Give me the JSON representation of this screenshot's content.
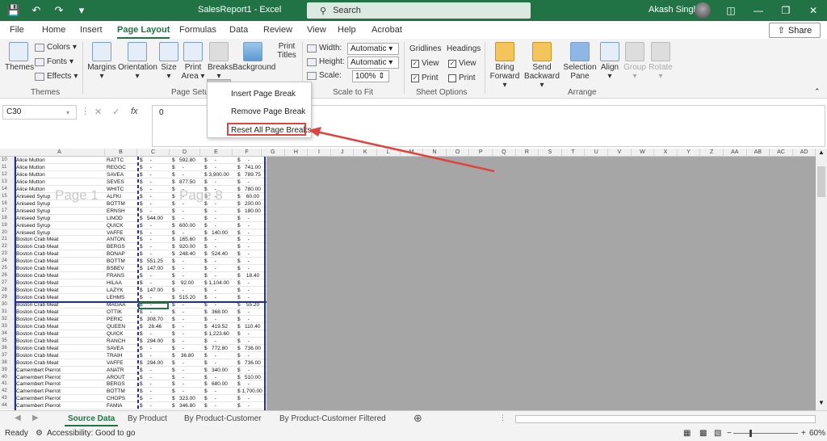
{
  "titlebar": {
    "title": "SalesReport1  -  Excel",
    "search_placeholder": "Search",
    "user_name": "Akash Singh"
  },
  "tabs": [
    "File",
    "Home",
    "Insert",
    "Page Layout",
    "Formulas",
    "Data",
    "Review",
    "View",
    "Help",
    "Acrobat"
  ],
  "active_tab": "Page Layout",
  "share_label": "Share",
  "ribbon": {
    "themes": {
      "themes": "Themes",
      "colors": "Colors",
      "fonts": "Fonts",
      "effects": "Effects",
      "group": "Themes"
    },
    "page_setup": {
      "margins": "Margins",
      "orientation": "Orientation",
      "size": "Size",
      "print_area_1": "Print",
      "print_area_2": "Area",
      "breaks": "Breaks",
      "background": "Background",
      "print_titles_1": "Print",
      "print_titles_2": "Titles",
      "group": "Page Setup"
    },
    "scale": {
      "width_label": "Width:",
      "width_value": "Automatic",
      "height_label": "Height:",
      "height_value": "Automatic",
      "scale_label": "Scale:",
      "scale_value": "100%",
      "group": "Scale to Fit"
    },
    "sheet_options": {
      "gridlines": "Gridlines",
      "headings": "Headings",
      "view": "View",
      "print": "Print",
      "group": "Sheet Options"
    },
    "arrange": {
      "bring_1": "Bring",
      "bring_2": "Forward",
      "send_1": "Send",
      "send_2": "Backward",
      "sel_1": "Selection",
      "sel_2": "Pane",
      "align": "Align",
      "group_btn": "Group",
      "rotate": "Rotate",
      "group": "Arrange"
    }
  },
  "breaks_menu": {
    "insert": "Insert Page Break",
    "remove": "Remove Page Break",
    "reset": "Reset All Page Breaks"
  },
  "formula_bar": {
    "name_box": "C30",
    "value": "0"
  },
  "columns": [
    "A",
    "B",
    "C",
    "D",
    "E",
    "F",
    "G",
    "H",
    "I",
    "J",
    "K",
    "L",
    "M",
    "N",
    "O",
    "P",
    "Q",
    "R",
    "S",
    "T",
    "U",
    "V",
    "W",
    "X",
    "Y",
    "Z",
    "AA",
    "AB",
    "AC",
    "AD"
  ],
  "page_watermarks": [
    "Page 1",
    "Page 8"
  ],
  "rows": [
    {
      "n": "10",
      "a": "Alice Mutton",
      "b": "RATTC",
      "c": "$     -",
      "d": "$   592.80",
      "e": "$     -",
      "f": "$     -"
    },
    {
      "n": "11",
      "a": "Alice Mutton",
      "b": "REGGC",
      "c": "$     -",
      "d": "$     -",
      "e": "$     -",
      "f": "$   741.00"
    },
    {
      "n": "12",
      "a": "Alice Mutton",
      "b": "SAVEA",
      "c": "$     -",
      "d": "$     -",
      "e": "$ 3,900.00",
      "f": "$   789.75"
    },
    {
      "n": "13",
      "a": "Alice Mutton",
      "b": "SEVES",
      "c": "$     -",
      "d": "$   877.50",
      "e": "$     -",
      "f": "$     -"
    },
    {
      "n": "14",
      "a": "Alice Mutton",
      "b": "WHITC",
      "c": "$     -",
      "d": "$     -",
      "e": "$     -",
      "f": "$   780.00"
    },
    {
      "n": "15",
      "a": "Aniseed Syrup",
      "b": "ALFKI",
      "c": "$     -",
      "d": "$     -",
      "e": "$     -",
      "f": "$    60.00"
    },
    {
      "n": "16",
      "a": "Aniseed Syrup",
      "b": "BOTTM",
      "c": "$     -",
      "d": "$     -",
      "e": "$     -",
      "f": "$   200.00"
    },
    {
      "n": "17",
      "a": "Aniseed Syrup",
      "b": "ERNSH",
      "c": "$     -",
      "d": "$     -",
      "e": "$     -",
      "f": "$   180.00"
    },
    {
      "n": "18",
      "a": "Aniseed Syrup",
      "b": "LINOD",
      "c": "$   544.00",
      "d": "$     -",
      "e": "$     -",
      "f": "$     -"
    },
    {
      "n": "19",
      "a": "Aniseed Syrup",
      "b": "QUICK",
      "c": "$     -",
      "d": "$   600.00",
      "e": "$     -",
      "f": "$     -"
    },
    {
      "n": "20",
      "a": "Aniseed Syrup",
      "b": "VAFFE",
      "c": "$     -",
      "d": "$     -",
      "e": "$   140.00",
      "f": "$     -"
    },
    {
      "n": "21",
      "a": "Boston Crab Meat",
      "b": "ANTON",
      "c": "$     -",
      "d": "$   165.60",
      "e": "$     -",
      "f": "$     -"
    },
    {
      "n": "22",
      "a": "Boston Crab Meat",
      "b": "BERGS",
      "c": "$     -",
      "d": "$   920.00",
      "e": "$     -",
      "f": "$     -"
    },
    {
      "n": "23",
      "a": "Boston Crab Meat",
      "b": "BONAP",
      "c": "$     -",
      "d": "$   248.40",
      "e": "$   524.40",
      "f": "$     -"
    },
    {
      "n": "24",
      "a": "Boston Crab Meat",
      "b": "BOTTM",
      "c": "$   551.25",
      "d": "$     -",
      "e": "$     -",
      "f": "$     -"
    },
    {
      "n": "25",
      "a": "Boston Crab Meat",
      "b": "BSBEV",
      "c": "$   147.00",
      "d": "$     -",
      "e": "$     -",
      "f": "$     -"
    },
    {
      "n": "26",
      "a": "Boston Crab Meat",
      "b": "FRANS",
      "c": "$     -",
      "d": "$     -",
      "e": "$     -",
      "f": "$    18.40"
    },
    {
      "n": "27",
      "a": "Boston Crab Meat",
      "b": "HILAA",
      "c": "$     -",
      "d": "$    92.00",
      "e": "$ 1,104.00",
      "f": "$     -"
    },
    {
      "n": "28",
      "a": "Boston Crab Meat",
      "b": "LAZYK",
      "c": "$   147.00",
      "d": "$     -",
      "e": "$     -",
      "f": "$     -"
    },
    {
      "n": "29",
      "a": "Boston Crab Meat",
      "b": "LEHMS",
      "c": "$     -",
      "d": "$   515.20",
      "e": "$     -",
      "f": "$     -"
    },
    {
      "n": "30",
      "a": "Boston Crab Meat",
      "b": "MAGAA",
      "c": "$     -",
      "d": "$     -",
      "e": "$     -",
      "f": "$    55.20"
    },
    {
      "n": "31",
      "a": "Boston Crab Meat",
      "b": "OTTIK",
      "c": "$     -",
      "d": "$     -",
      "e": "$   368.00",
      "f": "$     -"
    },
    {
      "n": "32",
      "a": "Boston Crab Meat",
      "b": "PERIC",
      "c": "$   308.70",
      "d": "$     -",
      "e": "$     -",
      "f": "$     -"
    },
    {
      "n": "33",
      "a": "Boston Crab Meat",
      "b": "QUEEN",
      "c": "$    26.46",
      "d": "$     -",
      "e": "$   419.52",
      "f": "$   110.40"
    },
    {
      "n": "34",
      "a": "Boston Crab Meat",
      "b": "QUICK",
      "c": "$     -",
      "d": "$     -",
      "e": "$ 1,223.60",
      "f": "$     -"
    },
    {
      "n": "35",
      "a": "Boston Crab Meat",
      "b": "RANCH",
      "c": "$   294.00",
      "d": "$     -",
      "e": "$     -",
      "f": "$     -"
    },
    {
      "n": "36",
      "a": "Boston Crab Meat",
      "b": "SAVEA",
      "c": "$     -",
      "d": "$     -",
      "e": "$   772.80",
      "f": "$   736.00"
    },
    {
      "n": "37",
      "a": "Boston Crab Meat",
      "b": "TRAIH",
      "c": "$     -",
      "d": "$    36.80",
      "e": "$     -",
      "f": "$     -"
    },
    {
      "n": "38",
      "a": "Boston Crab Meat",
      "b": "VAFFE",
      "c": "$   294.00",
      "d": "$     -",
      "e": "$     -",
      "f": "$   736.00"
    },
    {
      "n": "39",
      "a": "Camembert Pierrot",
      "b": "ANATR",
      "c": "$     -",
      "d": "$     -",
      "e": "$   340.00",
      "f": "$     -"
    },
    {
      "n": "40",
      "a": "Camembert Pierrot",
      "b": "AROUT",
      "c": "$     -",
      "d": "$     -",
      "e": "$     -",
      "f": "$   510.00"
    },
    {
      "n": "41",
      "a": "Camembert Pierrot",
      "b": "BERGS",
      "c": "$     -",
      "d": "$     -",
      "e": "$   680.00",
      "f": "$     -"
    },
    {
      "n": "42",
      "a": "Camembert Pierrot",
      "b": "BOTTM",
      "c": "$     -",
      "d": "$     -",
      "e": "$     -",
      "f": "$ 1,700.00"
    },
    {
      "n": "43",
      "a": "Camembert Pierrot",
      "b": "CHOPS",
      "c": "$     -",
      "d": "$   323.00",
      "e": "$     -",
      "f": "$     -"
    },
    {
      "n": "44",
      "a": "Camembert Pierrot",
      "b": "FAMIA",
      "c": "$     -",
      "d": "$   346.80",
      "e": "$     -",
      "f": "$     -"
    }
  ],
  "sheet_tabs": [
    "Source Data",
    "By Product",
    "By Product-Customer",
    "By Product-Customer Filtered"
  ],
  "active_sheet": "Source Data",
  "status": {
    "ready": "Ready",
    "accessibility": "Accessibility: Good to go",
    "zoom": "60%"
  }
}
